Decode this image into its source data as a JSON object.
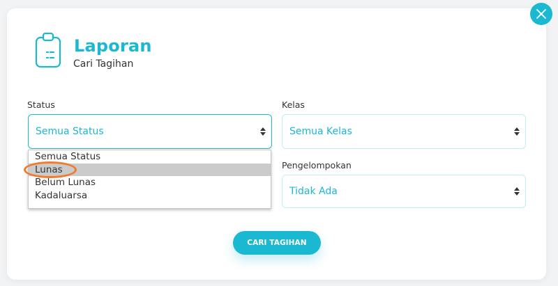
{
  "header": {
    "title": "Laporan",
    "subtitle": "Cari Tagihan"
  },
  "form": {
    "status": {
      "label": "Status",
      "selected": "Semua Status",
      "options": [
        "Semua Status",
        "Lunas",
        "Belum Lunas",
        "Kadaluarsa"
      ],
      "hovered_option": "Lunas"
    },
    "kelas": {
      "label": "Kelas",
      "selected": "Semua Kelas"
    },
    "pengelompokan": {
      "label": "Pengelompokan",
      "selected": "Tidak Ada"
    }
  },
  "actions": {
    "search_label": "CARI TAGIHAN"
  },
  "colors": {
    "accent": "#1bb8d2",
    "highlight": "#f07b2e"
  },
  "icons": {
    "close": "close-icon",
    "report": "clipboard-icon",
    "select_arrows": "sort-arrows-icon"
  }
}
